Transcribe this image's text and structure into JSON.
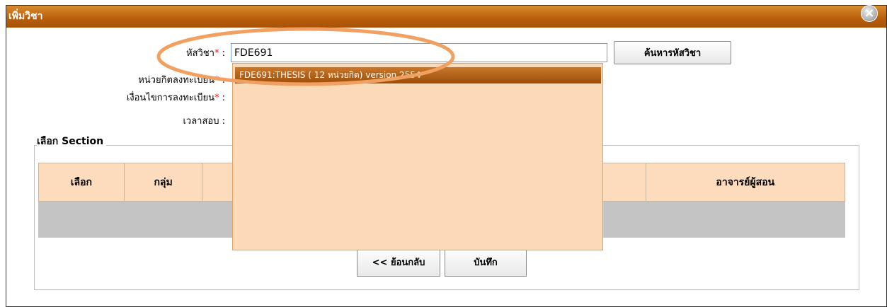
{
  "dialog": {
    "title": "เพิ่มวิชา",
    "close_icon": "×"
  },
  "form": {
    "course_code_label": "หัสวิชา",
    "course_code_value": "FDE691",
    "required_mark": "*",
    "colon": ":",
    "credits_label": "หน่วยกิตลงทะเบียน",
    "condition_label": "เงื่อนไขการลงทะเบียน",
    "exam_time_label": "เวลาสอบ",
    "search_button": "ค้นหารหัสวิชา"
  },
  "autocomplete": {
    "items": [
      "FDE691:THESIS ( 12 หน่วยกิต) version 2554"
    ]
  },
  "section": {
    "legend": "เลือก Section",
    "columns": [
      "เลือก",
      "กลุ่ม",
      "",
      "อาจารย์ผู้สอน"
    ]
  },
  "actions": {
    "back_button": "<< ย้อนกลับ",
    "save_button": "บันทึก"
  },
  "colors": {
    "titlebar": "#b85e0b",
    "dropdown_bg": "#fcdab8",
    "header_bg": "#fcdcbd",
    "annotation": "#f0a060"
  }
}
